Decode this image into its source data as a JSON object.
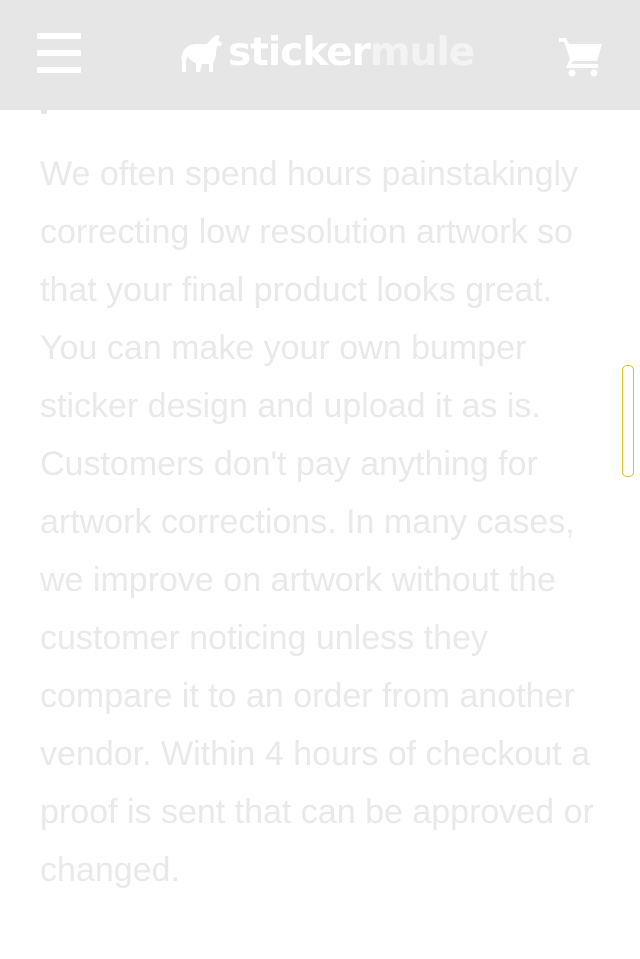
{
  "header": {
    "menu_icon": "hamburger-menu-icon",
    "logo": {
      "part1": "sticker",
      "part2": "mule",
      "icon": "mule-icon"
    },
    "cart_icon": "shopping-cart-icon"
  },
  "main": {
    "paragraph": "We often spend hours painstakingly correcting low resolution artwork so that your final product looks great. You can make your own bumper sticker design and upload it as is. Customers don't pay anything for artwork corrections. In many cases, we improve on artwork without the customer noticing unless they compare it to an order from another vendor. Within 4 hours of checkout a proof is sent that can be approved or changed."
  },
  "colors": {
    "header_bg": "#e6e6e6",
    "text": "#e9e9e9",
    "scrollbar_outline": "#e3bf22"
  }
}
